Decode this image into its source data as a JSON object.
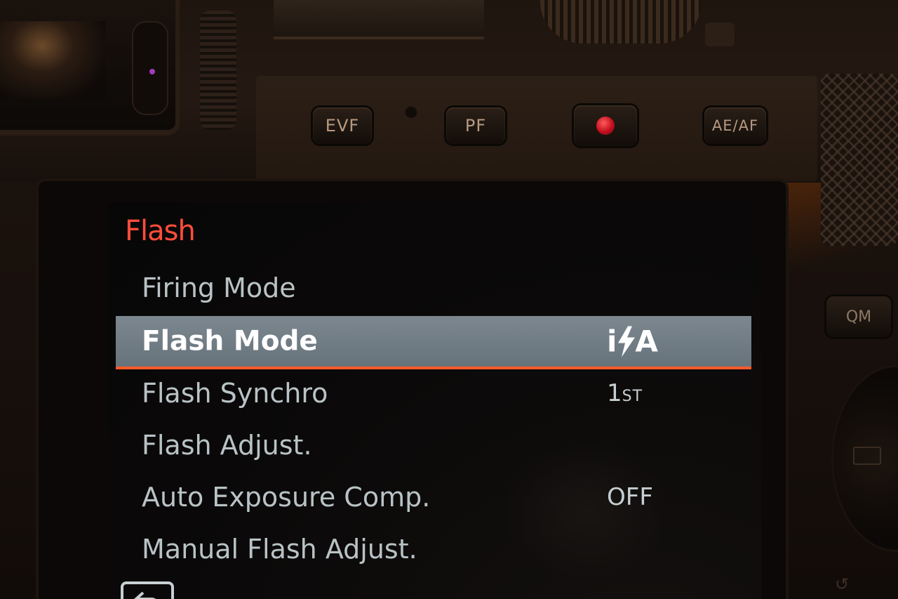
{
  "camera_buttons": {
    "evf_label": "EVF",
    "pf_label": "PF",
    "ae_af_label": "AE/AF",
    "qm_label": "QM"
  },
  "menu": {
    "header": "Flash",
    "items": [
      {
        "label": "Firing Mode",
        "value": ""
      },
      {
        "label": "Flash Mode",
        "value_prefix": "i",
        "value_suffix": "A",
        "value_icon": "flash-bolt-icon"
      },
      {
        "label": "Flash Synchro",
        "value_main": "1",
        "value_sub": "ST"
      },
      {
        "label": "Flash Adjust.",
        "value": ""
      },
      {
        "label": "Auto Exposure Comp.",
        "value": "OFF"
      },
      {
        "label": "Manual Flash Adjust.",
        "value": ""
      }
    ],
    "selected_index": 1
  },
  "colors": {
    "header": "#ff4d3a",
    "selection_bar": "#727e86",
    "selection_underline": "#ff5a2a",
    "record_button": "#c40f1e"
  },
  "icons": {
    "back": "back-arrow-icon",
    "record": "record-dot-icon"
  }
}
